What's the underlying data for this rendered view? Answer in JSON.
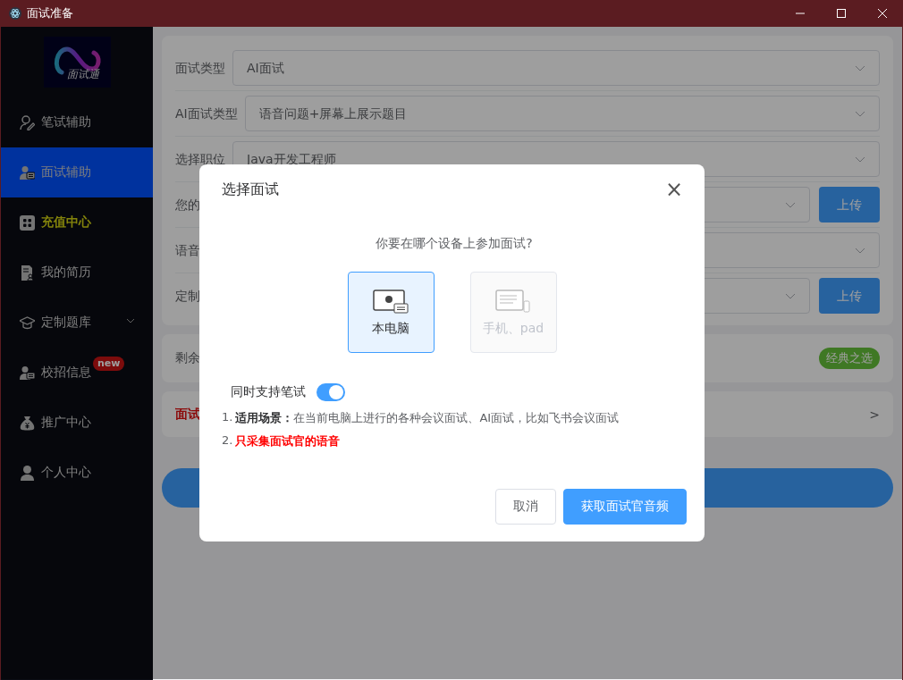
{
  "window": {
    "title": "面试准备"
  },
  "sidebar": {
    "logo_text": "面试通",
    "items": [
      {
        "label": "笔试辅助",
        "selected": false,
        "highlighted": false,
        "kind": "item"
      },
      {
        "label": "面试辅助",
        "selected": true,
        "highlighted": false,
        "kind": "item"
      },
      {
        "label": "充值中心",
        "selected": false,
        "highlighted": true,
        "kind": "item"
      },
      {
        "label": "我的简历",
        "selected": false,
        "highlighted": false,
        "kind": "item"
      },
      {
        "label": "定制题库",
        "selected": false,
        "highlighted": false,
        "kind": "group"
      },
      {
        "label": "校招信息",
        "selected": false,
        "highlighted": false,
        "kind": "item",
        "badge": "new"
      },
      {
        "label": "推广中心",
        "selected": false,
        "highlighted": false,
        "kind": "item"
      },
      {
        "label": "个人中心",
        "selected": false,
        "highlighted": false,
        "kind": "item"
      }
    ]
  },
  "form": {
    "rows": [
      {
        "label": "面试类型",
        "value": "AI面试",
        "kind": "select"
      },
      {
        "label": "AI面试类型",
        "value": "语音问题+屏幕上展示题目",
        "kind": "select"
      },
      {
        "label": "选择职位",
        "value": "Java开发工程师",
        "kind": "select"
      },
      {
        "label": "您的",
        "kind": "upload",
        "button": "上传"
      },
      {
        "label": "语音",
        "kind": "select"
      },
      {
        "label": "定制",
        "kind": "upload",
        "button": "上传"
      }
    ],
    "remaining": {
      "label": "剩余",
      "badge": "经典之选"
    },
    "notice": {
      "label": "面试",
      "arrow": ">"
    }
  },
  "dialog": {
    "title": "选择面试",
    "close": "×",
    "question": "你要在哪个设备上参加面试?",
    "devices": [
      {
        "label": "本电脑",
        "selected": true,
        "disabled": false
      },
      {
        "label": "手机、pad",
        "selected": false,
        "disabled": true
      }
    ],
    "toggle": {
      "label": "同时支持笔试",
      "on": true
    },
    "notes": [
      {
        "number": "1.",
        "text": "**适用场景：**在当前电脑上进行的各种会议面试、AI面试，比如飞书会议面试",
        "kind": "info"
      },
      {
        "number": "2.",
        "text": "只采集面试官的语音",
        "kind": "warning"
      }
    ],
    "buttons": [
      {
        "label": "取消",
        "kind": "secondary"
      },
      {
        "label": "获取面试官音频",
        "kind": "primary"
      }
    ]
  }
}
